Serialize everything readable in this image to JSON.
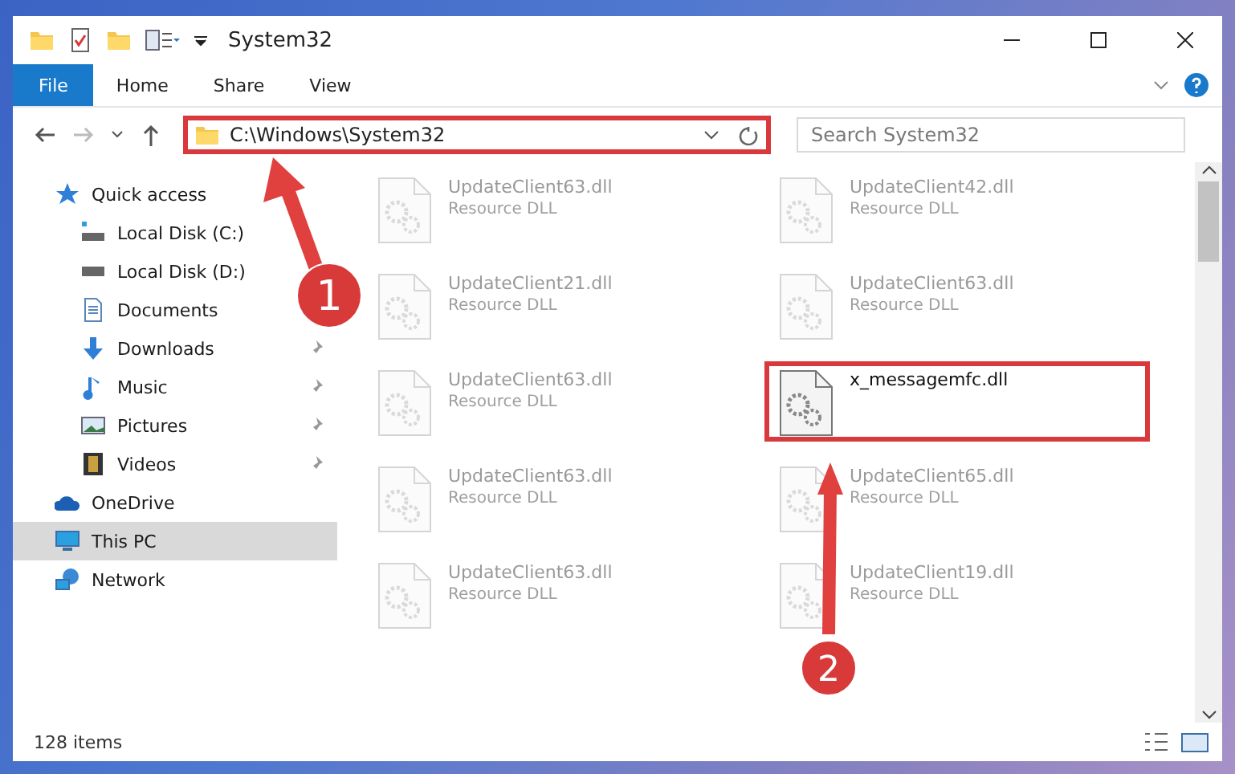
{
  "window": {
    "title": "System32"
  },
  "ribbon_tabs": [
    {
      "label": "File",
      "selected": true
    },
    {
      "label": "Home",
      "selected": false
    },
    {
      "label": "Share",
      "selected": false
    },
    {
      "label": "View",
      "selected": false
    }
  ],
  "address": {
    "path": "C:\\Windows\\System32",
    "highlighted": true
  },
  "search": {
    "placeholder": "Search System32"
  },
  "sidebar": {
    "items": [
      {
        "label": "Quick access",
        "kind": "quick",
        "pinned": false,
        "selected": false,
        "children": [
          {
            "label": "Local Disk (C:)",
            "kind": "diskc",
            "selected": false
          },
          {
            "label": "Local Disk (D:)",
            "kind": "disk",
            "selected": false
          },
          {
            "label": "Documents",
            "kind": "documents",
            "selected": false
          },
          {
            "label": "Downloads",
            "kind": "downloads",
            "pinned": true,
            "selected": false
          },
          {
            "label": "Music",
            "kind": "music",
            "pinned": true,
            "selected": false
          },
          {
            "label": "Pictures",
            "kind": "pictures",
            "pinned": true,
            "selected": false
          },
          {
            "label": "Videos",
            "kind": "videos",
            "pinned": true,
            "selected": false
          }
        ]
      },
      {
        "label": "OneDrive",
        "kind": "cloud",
        "pinned": false,
        "selected": false
      },
      {
        "label": "This PC",
        "kind": "pc",
        "pinned": false,
        "selected": true
      },
      {
        "label": "Network",
        "kind": "network",
        "pinned": false,
        "selected": false
      }
    ]
  },
  "files": [
    {
      "name": "UpdateClient63.dll",
      "type": "Resource DLL",
      "blurred": true,
      "highlighted": false
    },
    {
      "name": "UpdateClient42.dll",
      "type": "Resource DLL",
      "blurred": true,
      "highlighted": false
    },
    {
      "name": "UpdateClient21.dll",
      "type": "Resource DLL",
      "blurred": true,
      "highlighted": false
    },
    {
      "name": "UpdateClient63.dll",
      "type": "Resource DLL",
      "blurred": true,
      "highlighted": false
    },
    {
      "name": "UpdateClient63.dll",
      "type": "Resource DLL",
      "blurred": true,
      "highlighted": false
    },
    {
      "name": "x_messagemfc.dll",
      "blurred": false,
      "highlighted": true
    },
    {
      "name": "UpdateClient63.dll",
      "type": "Resource DLL",
      "blurred": true,
      "highlighted": false
    },
    {
      "name": "UpdateClient65.dll",
      "type": "Resource DLL",
      "blurred": true,
      "highlighted": false
    },
    {
      "name": "UpdateClient63.dll",
      "type": "Resource DLL",
      "blurred": true,
      "highlighted": false
    },
    {
      "name": "UpdateClient19.dll",
      "type": "Resource DLL",
      "blurred": true,
      "highlighted": false
    }
  ],
  "status_bar": {
    "count": "128 items"
  },
  "annotations": [
    {
      "number": "1"
    },
    {
      "number": "2"
    }
  ]
}
